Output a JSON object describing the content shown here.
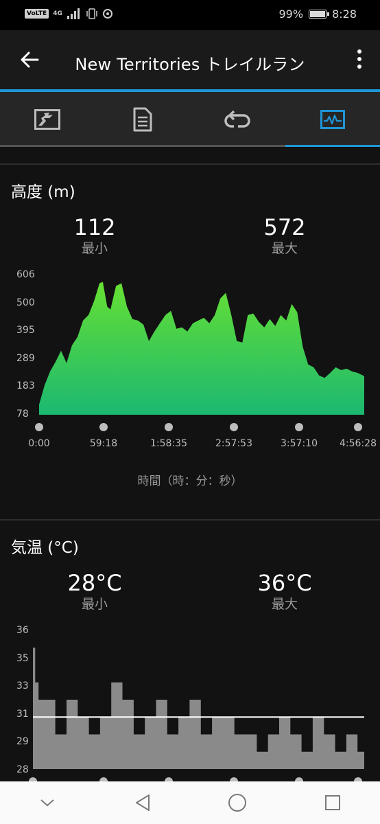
{
  "status": {
    "volte": "VoLTE",
    "network": "4G",
    "battery_pct": "99%",
    "time": "8:28"
  },
  "header": {
    "title": "New Territories トレイルラン",
    "back_icon": "arrow-left-icon",
    "menu_icon": "more-vert-icon"
  },
  "tabs": [
    {
      "icon": "map-icon",
      "active": false
    },
    {
      "icon": "document-icon",
      "active": false
    },
    {
      "icon": "laps-icon",
      "active": false
    },
    {
      "icon": "graph-icon",
      "active": true
    }
  ],
  "colors": {
    "accent": "#1e96d8",
    "elevation_top": "#66e033",
    "elevation_bottom": "#1bb871",
    "temperature_fill": "#8a8a8a"
  },
  "elevation": {
    "title": "高度 (m)",
    "min_value": "112",
    "min_label": "最小",
    "max_value": "572",
    "max_label": "最大",
    "y_ticks": [
      "606",
      "500",
      "395",
      "289",
      "183",
      "78"
    ],
    "x_ticks": [
      "0:00",
      "59:18",
      "1:58:35",
      "2:57:53",
      "3:57:10",
      "4:56:28"
    ],
    "x_label": "時間（時：分：秒）"
  },
  "temperature": {
    "title": "気温 (°C)",
    "min_value": "28°C",
    "min_label": "最小",
    "max_value": "36°C",
    "max_label": "最大",
    "y_ticks": [
      "36",
      "35",
      "33",
      "31",
      "29",
      "28"
    ],
    "average_line": 31
  },
  "chart_data": [
    {
      "type": "area",
      "title": "高度 (m)",
      "xlabel": "時間（時：分：秒）",
      "ylabel": "m",
      "x_ticks": [
        "0:00",
        "59:18",
        "1:58:35",
        "2:57:53",
        "3:57:10",
        "4:56:28"
      ],
      "ylim": [
        78,
        606
      ],
      "x_minutes": [
        0,
        5,
        10,
        15,
        20,
        25,
        30,
        35,
        40,
        45,
        50,
        55,
        58,
        62,
        65,
        70,
        75,
        80,
        85,
        90,
        95,
        100,
        105,
        110,
        115,
        120,
        125,
        130,
        135,
        140,
        145,
        150,
        155,
        160,
        165,
        170,
        175,
        180,
        185,
        190,
        195,
        200,
        205,
        210,
        215,
        220,
        225,
        230,
        235,
        240,
        245,
        250,
        255,
        260,
        265,
        270,
        275,
        280,
        285,
        290,
        296
      ],
      "values": [
        115,
        185,
        235,
        270,
        310,
        265,
        330,
        360,
        420,
        440,
        490,
        555,
        560,
        470,
        460,
        545,
        555,
        470,
        425,
        420,
        405,
        345,
        380,
        410,
        440,
        455,
        390,
        395,
        380,
        410,
        420,
        430,
        410,
        440,
        500,
        520,
        440,
        345,
        340,
        440,
        445,
        415,
        395,
        425,
        400,
        440,
        420,
        480,
        450,
        325,
        260,
        250,
        220,
        212,
        230,
        250,
        240,
        245,
        235,
        230,
        218
      ]
    },
    {
      "type": "area",
      "title": "気温 (°C)",
      "ylabel": "°C",
      "ylim": [
        28,
        36
      ],
      "average": 31,
      "x_minutes": [
        0,
        2,
        5,
        10,
        20,
        30,
        40,
        50,
        60,
        70,
        80,
        90,
        100,
        110,
        120,
        130,
        140,
        150,
        160,
        170,
        180,
        190,
        200,
        210,
        220,
        230,
        240,
        250,
        260,
        270,
        280,
        290,
        296
      ],
      "values": [
        35,
        33,
        32,
        32,
        30,
        32,
        31,
        30,
        31,
        33,
        32,
        30,
        31,
        32,
        30,
        31,
        32,
        30,
        31,
        31,
        30,
        30,
        29,
        30,
        31,
        30,
        29,
        31,
        30,
        29,
        30,
        29,
        28
      ]
    }
  ]
}
